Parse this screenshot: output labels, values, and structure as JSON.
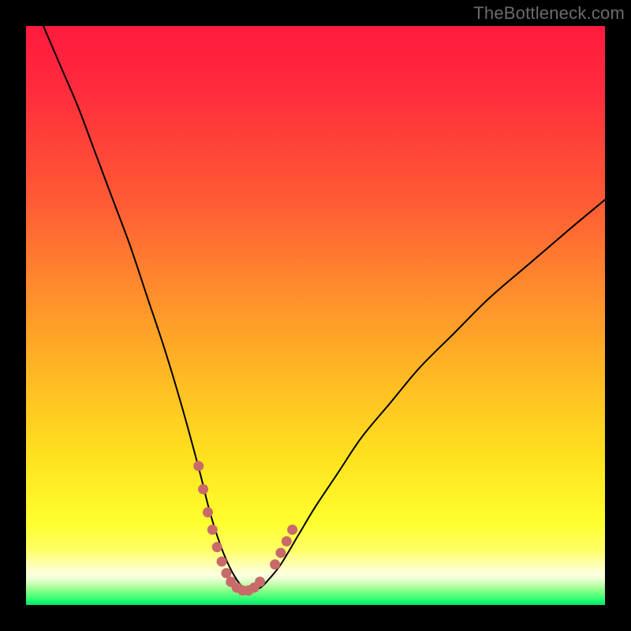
{
  "watermark": "TheBottleneck.com",
  "colors": {
    "background": "#000000",
    "curve": "#000000",
    "highlight": "#c96a6a",
    "gradient_top": "#ff1a3d",
    "gradient_mid": "#ffe31f",
    "gradient_bottom": "#0be468"
  },
  "chart_data": {
    "type": "line",
    "title": "",
    "xlabel": "",
    "ylabel": "",
    "xlim": [
      0,
      100
    ],
    "ylim": [
      0,
      100
    ],
    "grid": false,
    "legend": false,
    "annotations": [],
    "series": [
      {
        "name": "bottleneck-curve",
        "x": [
          3,
          6,
          9,
          12,
          15,
          18,
          21,
          24,
          27,
          30,
          31.5,
          33,
          34.5,
          36,
          37.5,
          39,
          40.5,
          42,
          44,
          47,
          50,
          54,
          58,
          63,
          68,
          74,
          80,
          87,
          94,
          100
        ],
        "y": [
          100,
          93,
          86,
          78,
          70,
          62,
          53,
          44,
          34,
          23,
          17,
          12,
          8,
          5,
          3,
          2.5,
          3,
          4.5,
          7,
          12,
          17,
          23,
          29,
          35,
          41,
          47,
          53,
          59,
          65,
          70
        ]
      },
      {
        "name": "highlight-left",
        "x": [
          29.8,
          30.6,
          31.4,
          32.2,
          33.0,
          33.8,
          34.6,
          35.4
        ],
        "y": [
          24,
          20,
          16,
          13,
          10,
          7.5,
          5.5,
          4
        ]
      },
      {
        "name": "highlight-bottom",
        "x": [
          35.4,
          36.4,
          37.4,
          38.4,
          39.4,
          40.4
        ],
        "y": [
          4,
          3,
          2.5,
          2.5,
          3,
          4
        ]
      },
      {
        "name": "highlight-right",
        "x": [
          43.0,
          44.0,
          45.0,
          46.0
        ],
        "y": [
          7,
          9,
          11,
          13
        ]
      }
    ]
  }
}
